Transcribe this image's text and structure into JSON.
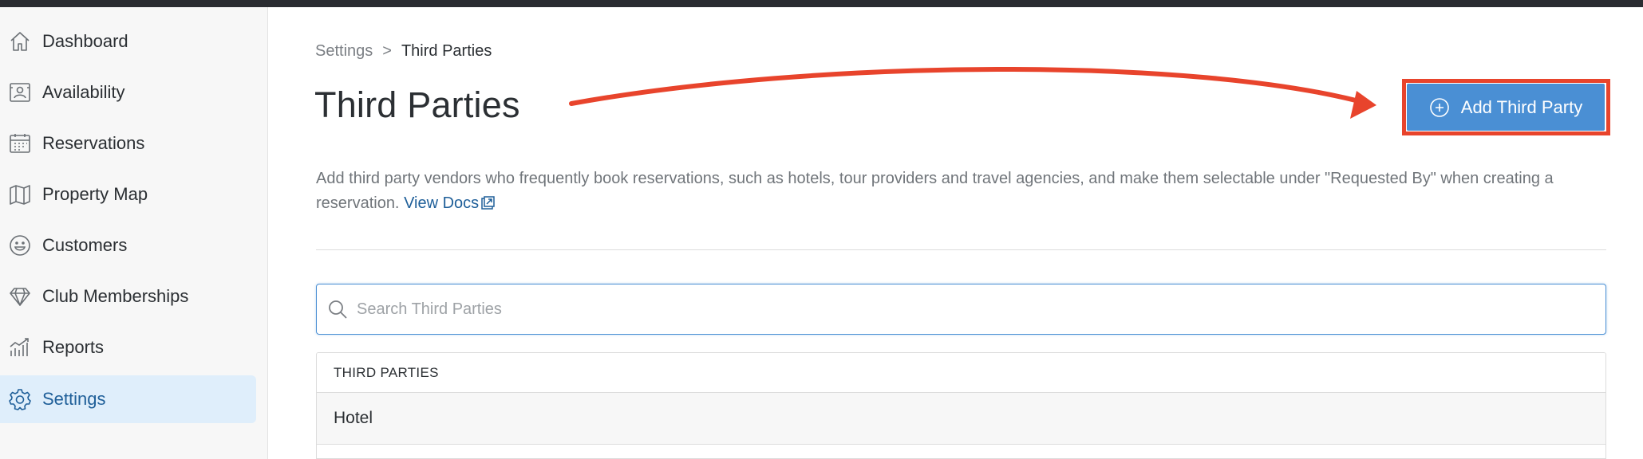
{
  "sidebar": {
    "items": [
      {
        "label": "Dashboard",
        "icon": "home-icon"
      },
      {
        "label": "Availability",
        "icon": "availability-icon"
      },
      {
        "label": "Reservations",
        "icon": "calendar-icon"
      },
      {
        "label": "Property Map",
        "icon": "map-icon"
      },
      {
        "label": "Customers",
        "icon": "smiley-icon"
      },
      {
        "label": "Club Memberships",
        "icon": "diamond-icon"
      },
      {
        "label": "Reports",
        "icon": "chart-icon"
      },
      {
        "label": "Settings",
        "icon": "gear-icon",
        "active": true
      }
    ]
  },
  "breadcrumb": {
    "parent": "Settings",
    "separator": ">",
    "current": "Third Parties"
  },
  "page": {
    "title": "Third Parties",
    "add_button_label": "Add Third Party",
    "description": "Add third party vendors who frequently book reservations, such as hotels, tour providers and travel agencies, and make them selectable under \"Requested By\" when creating a reservation.",
    "docs_link_label": "View Docs"
  },
  "search": {
    "placeholder": "Search Third Parties",
    "value": ""
  },
  "table": {
    "header": "THIRD PARTIES",
    "rows": [
      "Hotel"
    ]
  },
  "colors": {
    "accent": "#4a8fd4",
    "annotation": "#e8442c",
    "active_nav_bg": "#dfeefb",
    "link": "#1f5f99"
  }
}
